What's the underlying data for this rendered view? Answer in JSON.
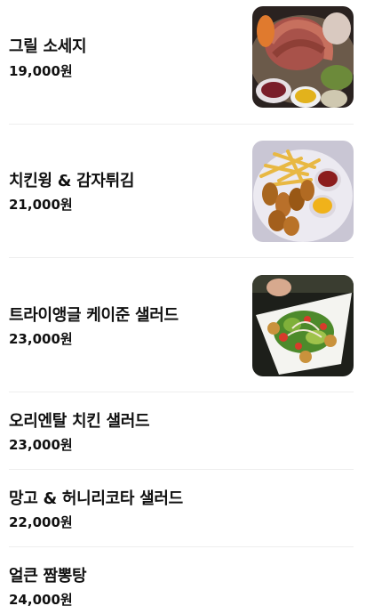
{
  "menu": {
    "items": [
      {
        "name": "그릴 소세지",
        "price": "19,000원",
        "has_photo": true
      },
      {
        "name": "치킨윙 & 감자튀김",
        "price": "21,000원",
        "has_photo": true
      },
      {
        "name": "트라이앵글 케이준 샐러드",
        "price": "23,000원",
        "has_photo": true
      },
      {
        "name": "오리엔탈 치킨 샐러드",
        "price": "23,000원",
        "has_photo": false
      },
      {
        "name": "망고 & 허니리코타 샐러드",
        "price": "22,000원",
        "has_photo": false
      },
      {
        "name": "얼큰 짬뽕탕",
        "price": "24,000원",
        "has_photo": false
      }
    ]
  }
}
